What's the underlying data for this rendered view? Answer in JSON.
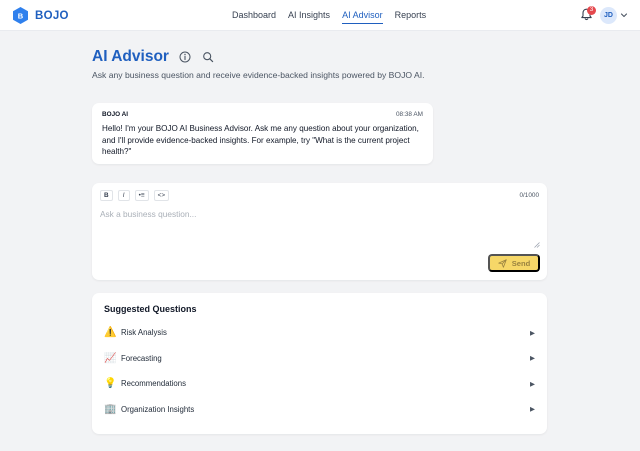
{
  "brand": {
    "name": "BOJO",
    "logo_letter": "B",
    "color": "#1f5fbf"
  },
  "nav": {
    "items": [
      {
        "label": "Dashboard",
        "active": false
      },
      {
        "label": "AI Insights",
        "active": false
      },
      {
        "label": "AI Advisor",
        "active": true
      },
      {
        "label": "Reports",
        "active": false
      }
    ]
  },
  "header": {
    "notifications": {
      "icon": "bell-icon",
      "count": "3",
      "badge_color": "#e5484d"
    },
    "user": {
      "initials": "JD",
      "menu_icon": "chevron-down-icon"
    }
  },
  "page": {
    "title": "AI Advisor",
    "title_icons": [
      "info-icon",
      "search-icon"
    ],
    "subtitle": "Ask any business question and receive evidence-backed insights powered by BOJO AI."
  },
  "message": {
    "sender": "BOJO AI",
    "time": "08:38 AM",
    "text": "Hello! I'm your BOJO AI Business Advisor. Ask me any question about your organization, and I'll provide evidence-backed insights. For example, try \"What is the current project health?\""
  },
  "composer": {
    "toolbar": {
      "bold": "B",
      "italic": "I",
      "list": "•≡",
      "code": "<>"
    },
    "char_count": "0/1000",
    "placeholder": "Ask a business question...",
    "value": "",
    "send_label": "Send",
    "send_icon": "paper-plane-icon",
    "send_color": "#f6d768"
  },
  "suggestions": {
    "title": "Suggested Questions",
    "items": [
      {
        "emoji": "⚠️",
        "icon": "warning-icon",
        "label": "Risk Analysis",
        "arrow": "▶"
      },
      {
        "emoji": "📈",
        "icon": "chart-increasing-icon",
        "label": "Forecasting",
        "arrow": "▶"
      },
      {
        "emoji": "💡",
        "icon": "light-bulb-icon",
        "label": "Recommendations",
        "arrow": "▶"
      },
      {
        "emoji": "🏢",
        "icon": "office-building-icon",
        "label": "Organization Insights",
        "arrow": "▶"
      }
    ]
  }
}
